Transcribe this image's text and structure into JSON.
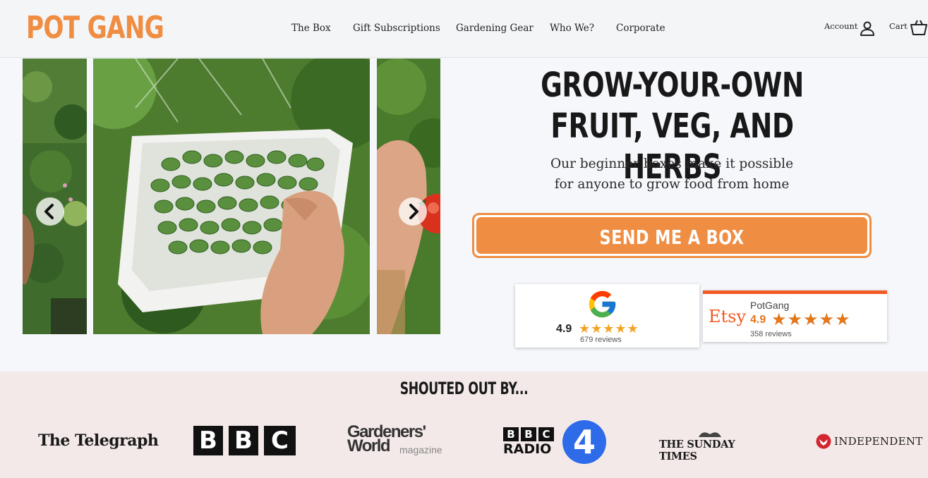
{
  "header": {
    "logo": "POT GANG",
    "nav": [
      "The Box",
      "Gift Subscriptions",
      "Gardening Gear",
      "Who We?",
      "Corporate"
    ],
    "account_label": "Account",
    "cart_label": "Cart"
  },
  "hero": {
    "title_line1": "GROW-YOUR-OWN",
    "title_line2": "FRUIT, VEG, AND HERBS",
    "subtitle_line1": "Our beginner boxes make it possible",
    "subtitle_line2": "for anyone to grow food from home",
    "cta_label": "SEND ME A BOX"
  },
  "reviews": {
    "google": {
      "rating": "4.9",
      "count_label": "679 reviews",
      "stars": "★★★★★"
    },
    "etsy": {
      "brand": "Etsy",
      "shop": "PotGang",
      "rating": "4.9",
      "count_label": "358 reviews",
      "stars": "★★★★★"
    }
  },
  "press": {
    "title": "SHOUTED OUT BY...",
    "telegraph": "The Telegraph",
    "bbc": [
      "B",
      "B",
      "C"
    ],
    "gw_line1": "Gardeners'",
    "gw_line2": "World",
    "gw_sub": "magazine",
    "radio_letters": [
      "B",
      "B",
      "C"
    ],
    "radio_label": "RADIO",
    "radio_num": "4",
    "sunday_times": "THE SUNDAY TIMES",
    "independent": "INDEPENDENT"
  },
  "colors": {
    "brand_orange": "#ef8d43",
    "etsy_orange": "#f05a24",
    "press_bg": "#f3e9e8",
    "star": "#f4a224"
  },
  "icons": [
    "account-icon",
    "cart-icon",
    "chevron-left-icon",
    "chevron-right-icon",
    "google-logo-icon",
    "star-icon"
  ]
}
